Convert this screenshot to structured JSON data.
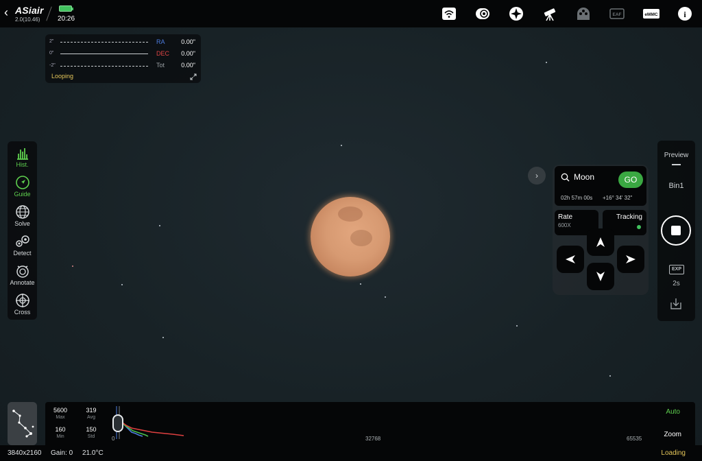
{
  "app": {
    "brand": "ASiair",
    "version": "2.0(10.46)",
    "clock": "20:26",
    "battery_color": "#41c25e"
  },
  "topbar_icons": [
    {
      "name": "wifi-icon",
      "label": ""
    },
    {
      "name": "camera-icon",
      "label": ""
    },
    {
      "name": "guide-scope-icon",
      "label": ""
    },
    {
      "name": "telescope-icon",
      "label": ""
    },
    {
      "name": "efw-icon",
      "label": "EFW"
    },
    {
      "name": "eaf-icon",
      "label": "EAF"
    },
    {
      "name": "emmc-icon",
      "label": "eMMC"
    },
    {
      "name": "info-icon",
      "label": "i"
    }
  ],
  "guide_graph": {
    "axis_labels": [
      "2\"",
      "0\"",
      "-2\""
    ],
    "rows": [
      {
        "key": "RA",
        "value": "0.00\"",
        "color": "#4d7de0"
      },
      {
        "key": "DEC",
        "value": "0.00\"",
        "color": "#e04444"
      },
      {
        "key": "Tot",
        "value": "0.00\"",
        "color": "#9aa0a4"
      }
    ],
    "status": "Looping"
  },
  "left_tools": [
    {
      "name": "hist",
      "label": "Hist.",
      "active": true
    },
    {
      "name": "guide",
      "label": "Guide",
      "active": true
    },
    {
      "name": "solve",
      "label": "Solve",
      "active": false
    },
    {
      "name": "detect",
      "label": "Detect",
      "active": false
    },
    {
      "name": "annotate",
      "label": "Annotate",
      "active": false
    },
    {
      "name": "cross",
      "label": "Cross",
      "active": false
    }
  ],
  "mount": {
    "target": "Moon",
    "go_label": "GO",
    "ra": "02h 57m 00s",
    "dec": "+16° 34' 32\"",
    "rate_label": "Rate",
    "rate_value": "600X",
    "tracking_label": "Tracking",
    "tracking_on": true
  },
  "right_panel": {
    "mode": "Preview",
    "bin": "Bin1",
    "exp_label": "EXP",
    "exp_time": "2s"
  },
  "histogram": {
    "max_value": "5600",
    "max_label": "Max",
    "avg_value": "319",
    "avg_label": "Avg",
    "min_value": "160",
    "min_label": "Min",
    "std_value": "150",
    "std_label": "Std",
    "tick_start": "0",
    "tick_mid": "32768",
    "tick_end": "65535",
    "auto_label": "Auto",
    "zoom_label": "Zoom"
  },
  "status": {
    "resolution": "3840x2160",
    "gain": "Gain: 0",
    "temperature": "21.0°C",
    "state": "Loading"
  }
}
